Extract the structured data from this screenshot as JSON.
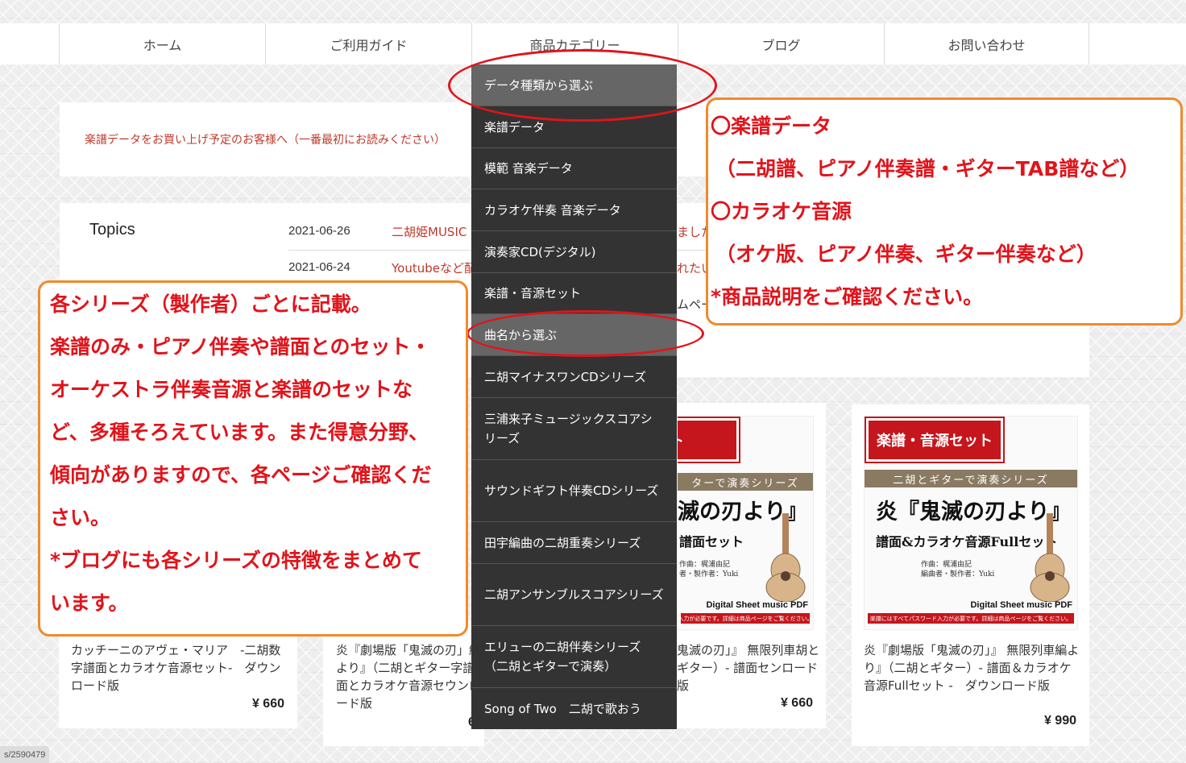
{
  "nav": {
    "items": [
      "ホーム",
      "ご利用ガイド",
      "商品カテゴリー",
      "ブログ",
      "お問い合わせ"
    ]
  },
  "notice": {
    "text": "楽譜データをお買い上げ予定のお客様へ（一番最初にお読みください）"
  },
  "topics": {
    "heading": "Topics",
    "items": [
      {
        "date": "2021-06-26",
        "title": "二胡姫MUSIC"
      },
      {
        "date": "2021-06-24",
        "title": "Youtubeなど配"
      }
    ],
    "fragments": [
      "ました",
      "れたい",
      "ムペー"
    ]
  },
  "dropdown": {
    "items": [
      "データ種類から選ぶ",
      "楽譜データ",
      "模範 音楽データ",
      "カラオケ伴奏 音楽データ",
      "演奏家CD(デジタル)",
      "楽譜・音源セット",
      "曲名から選ぶ",
      "二胡マイナスワンCDシリーズ",
      "三浦来子ミュージックスコアシリーズ",
      "サウンドギフト伴奏CDシリーズ",
      "田宇編曲の二胡重奏シリーズ",
      "二胡アンサンブルスコアシリーズ",
      "エリューの二胡伴奏シリーズ（二胡とギターで演奏）",
      "Song of Two　二胡で歌おう"
    ]
  },
  "callout_right": {
    "lines": [
      "〇楽譜データ",
      "（二胡譜、ピアノ伴奏譜・ギターTAB譜など）",
      "〇カラオケ音源",
      "（オケ版、ピアノ伴奏、ギター伴奏など）",
      "*商品説明をご確認ください。"
    ]
  },
  "callout_left": {
    "lines": [
      "各シリーズ（製作者）ごとに記載。",
      "楽譜のみ・ピアノ伴奏や譜面とのセット・",
      "オーケストラ伴奏音源と楽譜のセットな",
      "ど、多種そろえています。また得意分野、",
      "傾向がありますので、各ページご確認くだ",
      "さい。",
      "*ブログにも各シリーズの特徴をまとめて",
      "います。"
    ]
  },
  "products": [
    {
      "title": "カッチーニのアヴェ・マリア　-二胡数字譜面とカラオケ音源セット-　ダウンロード版",
      "price": "¥ 660"
    },
    {
      "title": "炎『劇場版「鬼滅の刃」』無限列車編より』（二胡とギター）- 数字譜面とカラオケ音源セット - ダウンロード版",
      "price": "¥ 660"
    },
    {
      "title": "炎『劇場版「鬼滅の刃」』 無限列車編より』（二胡とギター）- 譜面セット - ダウンロード版",
      "price": "¥ 660"
    },
    {
      "title": "炎『劇場版「鬼滅の刃」』 無限列車編より』（二胡とギター）- 譜面＆カラオケ音源Fullセット - ダウンロード版",
      "price": "¥ 990"
    }
  ],
  "card_texts": {
    "card2_visible": "炎『劇場版「鬼滅の刃」編より』（二胡とギター字譜面とカラオケ音源セウンロード版",
    "card3_visible": "鬼滅の刃」』 無限列車胡とギター）- 譜面センロード版",
    "card4_visible": "炎『劇場版「鬼滅の刃」』 無限列車編より』（二胡とギター）- 譜面＆カラオケ音源Fullセット -　ダウンロード版",
    "card2_price_partial": "660"
  },
  "product_image_left": {
    "badge": "ット",
    "band": "ターで演奏シリーズ",
    "big": "滅の刃より』",
    "sub": "譜面セット",
    "credit": "作曲：梶浦由記\n者・製作者：Yuki",
    "pdf": "Digital Sheet music PDF",
    "password": "入力が必要です。詳細は商品ページをご覧ください。"
  },
  "product_image_right": {
    "badge": "楽譜・音源セット",
    "band": "二胡とギターで演奏シリーズ",
    "big": "炎『鬼滅の刃より』",
    "sub": "譜面&カラオケ音源Fullセット",
    "credit": "作曲：梶浦由記\n編曲者・製作者：Yuki",
    "pdf": "Digital Sheet music PDF",
    "password": "楽譜にはすべてパスワード入力が必要です。詳細は商品ページをご覧ください。"
  },
  "status": {
    "text": "s/2590479"
  },
  "colors": {
    "accent_red": "#e0141b",
    "callout_orange": "#f08a2c",
    "dropdown_bg": "#333333",
    "link_red": "#c0392b"
  }
}
